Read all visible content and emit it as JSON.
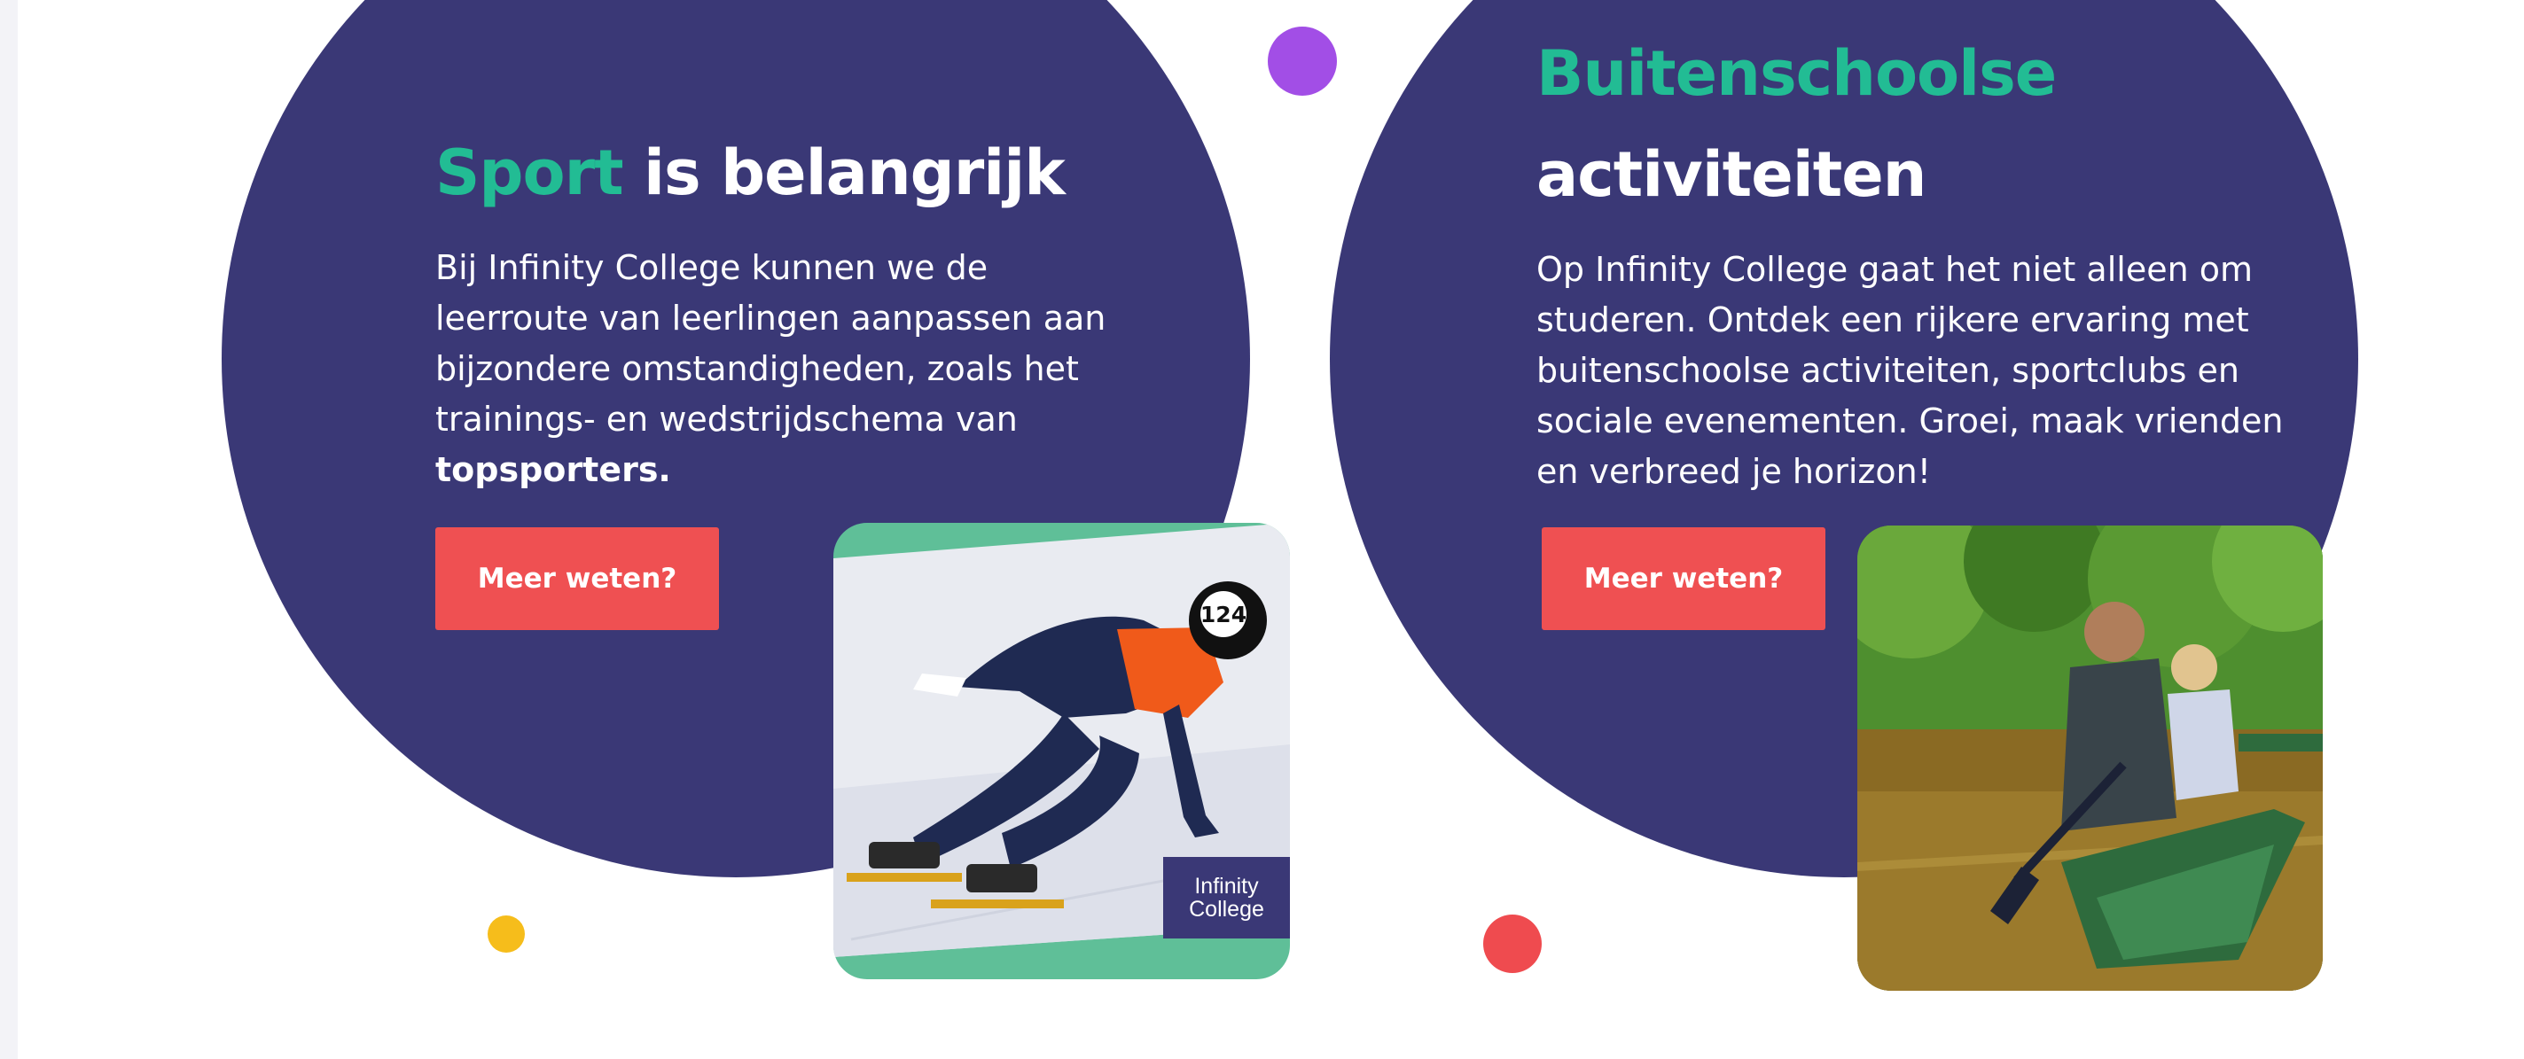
{
  "sport": {
    "heading_accent": "Sport",
    "heading_rest": "is belangrijk",
    "body": "Bij Infinity College kunnen we de leerroute van leerlingen aanpassen aan bijzondere omstandigheden, zoals het trainings- en wedstrijdschema van",
    "body_bold": "topsporters.",
    "button_label": "Meer weten?",
    "photo_logo_line1": "Infinity",
    "photo_logo_line2": "College",
    "helmet_number": "124"
  },
  "activities": {
    "heading_accent": "Buitenschoolse",
    "heading_rest": "activiteiten",
    "body": "Op Infinity College gaat het niet alleen om studeren. Ontdek een rijkere ervaring met buitenschoolse activiteiten, sportclubs en sociale evenementen. Groei, maak vrienden en verbreed je horizon!",
    "button_label": "Meer weten?"
  },
  "colors": {
    "circle": "#3a3876",
    "accent": "#22bc94",
    "button": "#ef5052",
    "dot_purple": "#a24ee6",
    "dot_yellow": "#f6bd1b",
    "dot_red": "#ef4b4f"
  }
}
